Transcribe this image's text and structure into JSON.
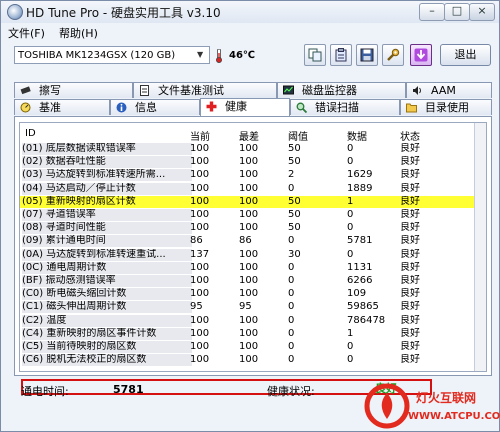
{
  "window": {
    "title": "HD Tune Pro - 硬盘实用工具 v3.10",
    "min_label": "–",
    "max_label": "□",
    "close_label": "×"
  },
  "menu": [
    "文件(F)",
    "帮助(H)"
  ],
  "toolbar": {
    "drive": "TOSHIBA MK1234GSX (120 GB)",
    "temperature": "46℃",
    "exit_label": "退出"
  },
  "tabs_top": [
    {
      "label": "擦写",
      "icon": "erase-icon"
    },
    {
      "label": "文件基准测试",
      "icon": "file-benchmark-icon"
    },
    {
      "label": "磁盘监控器",
      "icon": "disk-monitor-icon"
    },
    {
      "label": "AAM",
      "icon": "speaker-icon"
    }
  ],
  "tabs_bottom": [
    {
      "label": "基准",
      "icon": "benchmark-icon"
    },
    {
      "label": "信息",
      "icon": "info-icon"
    },
    {
      "label": "健康",
      "icon": "health-cross-icon",
      "active": true
    },
    {
      "label": "错误扫描",
      "icon": "magnifier-icon"
    },
    {
      "label": "目录使用",
      "icon": "folder-icon"
    }
  ],
  "columns": [
    "ID",
    "当前",
    "最差",
    "阈值",
    "数据",
    "状态"
  ],
  "rows": [
    {
      "name": "(01) 底层数据读取错误率",
      "cur": "100",
      "worst": "100",
      "thr": "50",
      "data": "0",
      "status": "良好"
    },
    {
      "name": "(02) 数据吞吐性能",
      "cur": "100",
      "worst": "100",
      "thr": "50",
      "data": "0",
      "status": "良好"
    },
    {
      "name": "(03) 马达旋转到标准转速所需...",
      "cur": "100",
      "worst": "100",
      "thr": "2",
      "data": "1629",
      "status": "良好"
    },
    {
      "name": "(04) 马达启动／停止计数",
      "cur": "100",
      "worst": "100",
      "thr": "0",
      "data": "1889",
      "status": "良好"
    },
    {
      "name": "(05) 重新映射的扇区计数",
      "cur": "100",
      "worst": "100",
      "thr": "50",
      "data": "1",
      "status": "良好",
      "highlight": "yellow"
    },
    {
      "name": "(07) 寻道错误率",
      "cur": "100",
      "worst": "100",
      "thr": "50",
      "data": "0",
      "status": "良好"
    },
    {
      "name": "(08) 寻道时间性能",
      "cur": "100",
      "worst": "100",
      "thr": "50",
      "data": "0",
      "status": "良好"
    },
    {
      "name": "(09) 累计通电时间",
      "cur": "86",
      "worst": "86",
      "thr": "0",
      "data": "5781",
      "status": "良好"
    },
    {
      "name": "(0A) 马达旋转到标准转速重试...",
      "cur": "137",
      "worst": "100",
      "thr": "30",
      "data": "0",
      "status": "良好"
    },
    {
      "name": "(0C) 通电周期计数",
      "cur": "100",
      "worst": "100",
      "thr": "0",
      "data": "1131",
      "status": "良好",
      "highlight": "red"
    },
    {
      "name": "(BF) 振动感测错误率",
      "cur": "100",
      "worst": "100",
      "thr": "0",
      "data": "6266",
      "status": "良好"
    },
    {
      "name": "(C0) 断电磁头缩回计数",
      "cur": "100",
      "worst": "100",
      "thr": "0",
      "data": "109",
      "status": "良好"
    },
    {
      "name": "(C1) 磁头伸出周期计数",
      "cur": "95",
      "worst": "95",
      "thr": "0",
      "data": "59865",
      "status": "良好"
    },
    {
      "name": "(C2) 温度",
      "cur": "100",
      "worst": "100",
      "thr": "0",
      "data": "786478",
      "status": "良好"
    },
    {
      "name": "(C4) 重新映射的扇区事件计数",
      "cur": "100",
      "worst": "100",
      "thr": "0",
      "data": "1",
      "status": "良好"
    },
    {
      "name": "(C5) 当前待映射的扇区数",
      "cur": "100",
      "worst": "100",
      "thr": "0",
      "data": "0",
      "status": "良好"
    },
    {
      "name": "(C6) 脱机无法校正的扇区数",
      "cur": "100",
      "worst": "100",
      "thr": "0",
      "data": "0",
      "status": "良好"
    }
  ],
  "status_bar": {
    "power_on_label": "通电时间:",
    "power_on_value": "5781",
    "health_label": "健康状况:",
    "health_value": "良好"
  },
  "watermark": {
    "cn": "灯火互联网",
    "url": "WWW.ATCPU.COM"
  },
  "colors": {
    "highlight_yellow": "#ffff33",
    "highlight_red": "#d41010",
    "health_ok": "#1f9a1f",
    "watermark_red": "#e22a1e"
  }
}
